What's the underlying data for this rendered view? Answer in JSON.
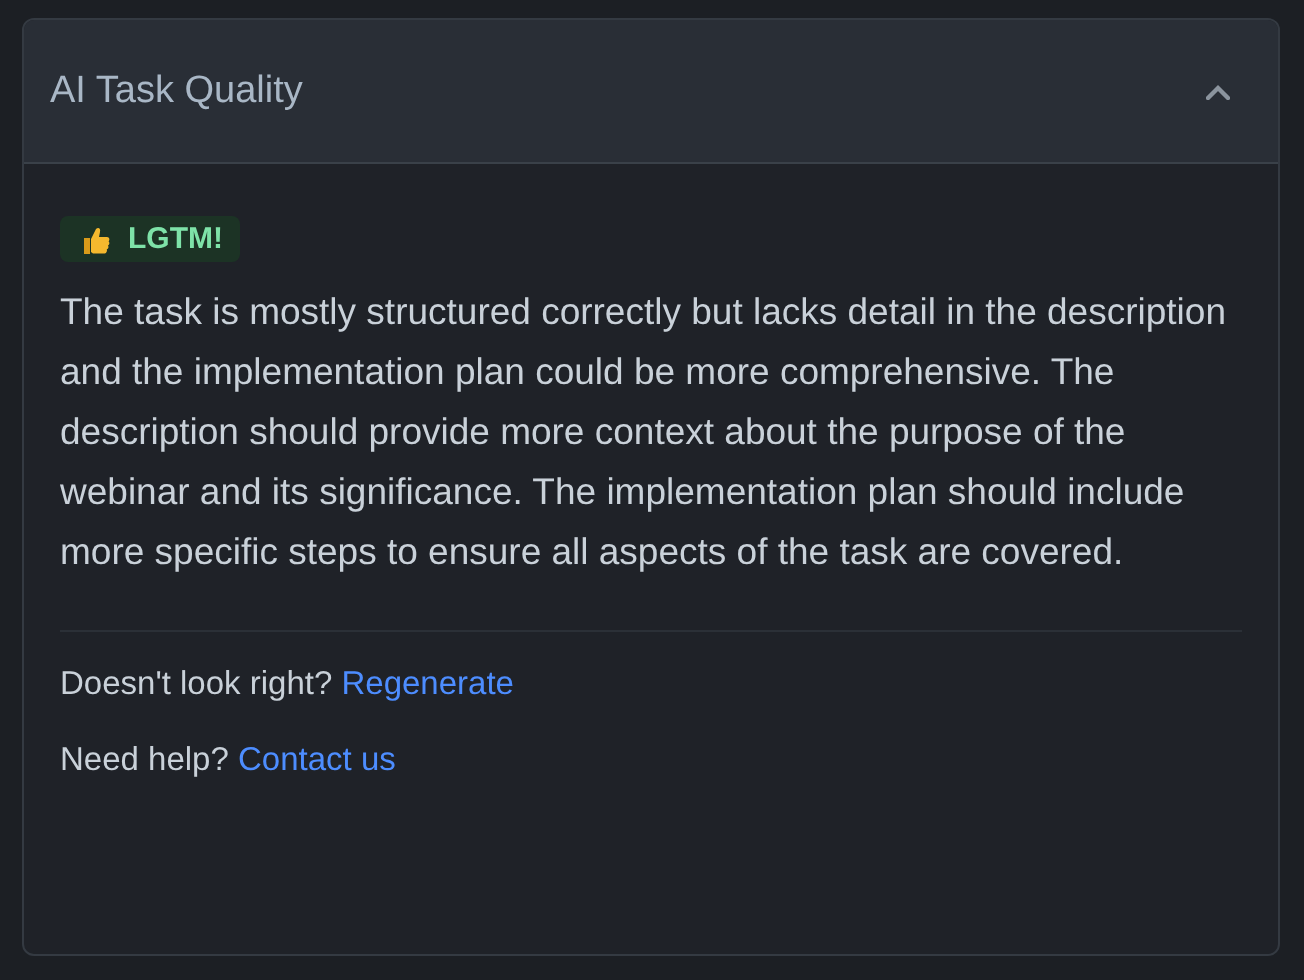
{
  "panel": {
    "title": "AI Task Quality",
    "expanded": true
  },
  "verdict": {
    "label": "LGTM!"
  },
  "summary": "The task is mostly structured correctly but lacks detail in the description and the implementation plan could be more comprehensive. The description should provide more context about the purpose of the webinar and its significance. The implementation plan should include more specific steps to ensure all aspects of the task are covered.",
  "footer": [
    {
      "prompt": "Doesn't look right?",
      "link": "Regenerate"
    },
    {
      "prompt": "Need help?",
      "link": "Contact us"
    }
  ]
}
